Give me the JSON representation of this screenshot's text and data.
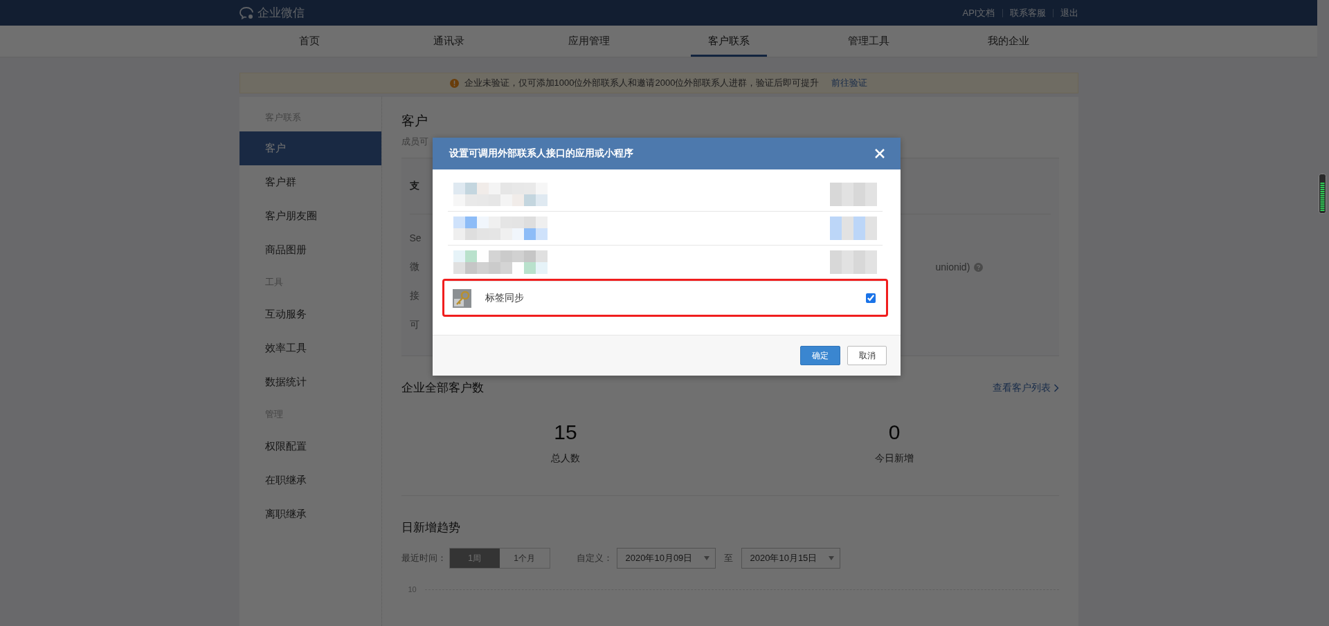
{
  "topbar": {
    "logo": "企业微信",
    "links": [
      "API文档",
      "联系客服",
      "退出"
    ]
  },
  "nav": [
    {
      "label": "首页",
      "selected": false
    },
    {
      "label": "通讯录",
      "selected": false
    },
    {
      "label": "应用管理",
      "selected": false
    },
    {
      "label": "客户联系",
      "selected": true
    },
    {
      "label": "管理工具",
      "selected": false
    },
    {
      "label": "我的企业",
      "selected": false
    }
  ],
  "notice": {
    "text": "企业未验证，仅可添加1000位外部联系人和邀请2000位外部联系人进群，验证后即可提升",
    "link": "前往验证"
  },
  "sidebar": [
    {
      "title": "客户联系",
      "items": [
        {
          "label": "客户",
          "selected": true
        },
        {
          "label": "客户群",
          "selected": false
        },
        {
          "label": "客户朋友圈",
          "selected": false
        },
        {
          "label": "商品图册",
          "selected": false
        }
      ]
    },
    {
      "title": "工具",
      "items": [
        {
          "label": "互动服务",
          "selected": false
        },
        {
          "label": "效率工具",
          "selected": false
        },
        {
          "label": "数据统计",
          "selected": false
        }
      ]
    },
    {
      "title": "管理",
      "items": [
        {
          "label": "权限配置",
          "selected": false
        },
        {
          "label": "在职继承",
          "selected": false
        },
        {
          "label": "离职继承",
          "selected": false
        }
      ]
    }
  ],
  "page": {
    "title": "客户",
    "subtitle": "成员可",
    "card_header": "支",
    "card_rows": [
      "Se",
      "微",
      "接",
      "可"
    ],
    "card_note": "unionid)"
  },
  "stats": {
    "title": "企业全部客户数",
    "link": "查看客户列表",
    "items": [
      {
        "value": "15",
        "label": "总人数"
      },
      {
        "value": "0",
        "label": "今日新增"
      }
    ]
  },
  "trend": {
    "title": "日新增趋势",
    "range_label": "最近时间：",
    "ranges": [
      {
        "label": "1周",
        "selected": true
      },
      {
        "label": "1个月",
        "selected": false
      }
    ],
    "custom_label": "自定义：",
    "start": "2020年10月09日",
    "to": "至",
    "end": "2020年10月15日",
    "y_tick": "10"
  },
  "dialog": {
    "title": "设置可调用外部联系人接口的应用或小程序",
    "items": [
      {
        "kind": "obscured"
      },
      {
        "kind": "obscured"
      },
      {
        "kind": "obscured"
      },
      {
        "kind": "app",
        "name": "标签同步",
        "checked": true,
        "highlighted": true
      }
    ],
    "confirm": "确定",
    "cancel": "取消"
  }
}
